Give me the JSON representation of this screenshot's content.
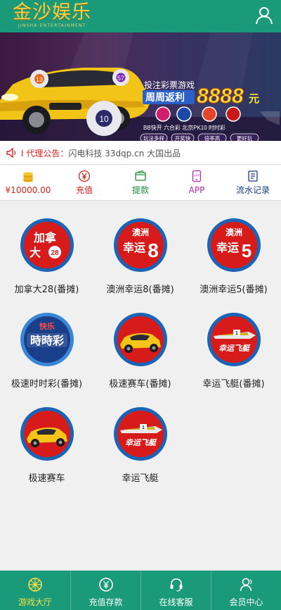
{
  "header": {
    "logo_text": "金沙娱乐",
    "logo_subtitle": "JINSHA ENTERTAINMENT",
    "user_icon": "user-icon"
  },
  "banner": {
    "headline": "投注彩票游戏",
    "promo_label": "周周返利",
    "promo_amount": "8888",
    "promo_unit": "元",
    "lottery_names": "BB快开  六合彩  北京PK10  时时彩",
    "tags": [
      "玩法多样",
      "开奖快",
      "倍率高",
      "更好玩"
    ],
    "ball_numbers": [
      "13",
      "57",
      "10"
    ]
  },
  "notice": {
    "icon": "speaker-icon",
    "label": "I 代理公告：",
    "text": "闪电科技 33dqp.cn 大国出品"
  },
  "quick_actions": [
    {
      "label": "¥10000.00",
      "icon": "coins-icon",
      "color": "#d0231b"
    },
    {
      "label": "充值",
      "icon": "yen-circle-icon",
      "color": "#d0231b"
    },
    {
      "label": "提款",
      "icon": "wallet-icon",
      "color": "#1a8a3a"
    },
    {
      "label": "APP",
      "icon": "app-icon",
      "color": "#b02aa8"
    },
    {
      "label": "流水记录",
      "icon": "record-icon",
      "color": "#1a3a8a"
    }
  ],
  "games": [
    {
      "label": "加拿大28(番摊)",
      "icon_text": "加拿大",
      "icon_num": "28"
    },
    {
      "label": "澳洲幸运8(番摊)",
      "icon_top": "澳洲",
      "icon_main": "幸运",
      "icon_num": "8"
    },
    {
      "label": "澳洲幸运5(番摊)",
      "icon_top": "澳洲",
      "icon_main": "幸运",
      "icon_num": "5"
    },
    {
      "label": "极速时时彩(番摊)",
      "icon_top": "快乐",
      "icon_main": "時時彩"
    },
    {
      "label": "极速赛车(番摊)"
    },
    {
      "label": "幸运飞艇(番摊)",
      "icon_main": "幸运飞艇"
    },
    {
      "label": "极速赛车"
    },
    {
      "label": "幸运飞艇",
      "icon_main": "幸运飞艇"
    }
  ],
  "tabbar": [
    {
      "label": "游戏大厅",
      "icon": "lobby-icon",
      "active": true
    },
    {
      "label": "充值存款",
      "icon": "deposit-icon",
      "active": false
    },
    {
      "label": "在线客服",
      "icon": "headset-icon",
      "active": false
    },
    {
      "label": "会员中心",
      "icon": "member-icon",
      "active": false
    }
  ],
  "colors": {
    "brand_green": "#1a9a78",
    "active_tab": "#f4e04a",
    "game_red": "#d71a1a",
    "game_ring": "#1a63b5"
  }
}
